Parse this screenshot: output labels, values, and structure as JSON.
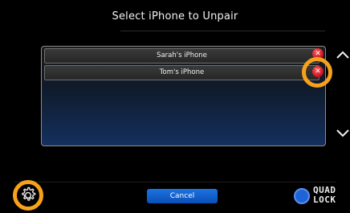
{
  "title": "Select iPhone to Unpair",
  "devices": [
    {
      "label": "Sarah's iPhone"
    },
    {
      "label": "Tom's iPhone"
    }
  ],
  "icons": {
    "remove": "close-icon",
    "up": "chevron-up-icon",
    "down": "chevron-down-icon",
    "settings": "gear-icon"
  },
  "cancel_label": "Cancel",
  "brand": {
    "line1": "QUAD",
    "line2": "LOCK"
  },
  "colors": {
    "highlight": "#f7a21b",
    "remove": "#d0101e",
    "button": "#0a5fd0",
    "background": "#000000"
  }
}
